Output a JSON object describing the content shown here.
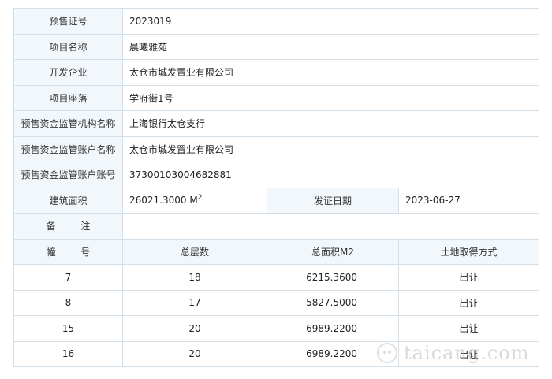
{
  "info": {
    "presale_no_label": "预售证号",
    "presale_no": "2023019",
    "project_name_label": "项目名称",
    "project_name": "晨曦雅苑",
    "developer_label": "开发企业",
    "developer": "太仓市城发置业有限公司",
    "location_label": "项目座落",
    "location": "学府街1号",
    "supervisor_label": "预售资金监管机构名称",
    "supervisor": "上海银行太仓支行",
    "account_name_label": "预售资金监管账户名称",
    "account_name": "太仓市城发置业有限公司",
    "account_no_label": "预售资金监管账户账号",
    "account_no": "37300103004682881",
    "area_label": "建筑面积",
    "area_value": "26021.3000",
    "area_unit": "M",
    "area_unit_sup": "2",
    "issue_date_label": "发证日期",
    "issue_date": "2023-06-27",
    "remarks_label": "备 注",
    "remarks": ""
  },
  "buildings": {
    "headers": {
      "building": "幢 号",
      "floors": "总层数",
      "area": "总面积M2",
      "land": "土地取得方式"
    },
    "rows": [
      {
        "building": "7",
        "floors": "18",
        "area": "6215.3600",
        "land": "出让"
      },
      {
        "building": "8",
        "floors": "17",
        "area": "5827.5000",
        "land": "出让"
      },
      {
        "building": "15",
        "floors": "20",
        "area": "6989.2200",
        "land": "出让"
      },
      {
        "building": "16",
        "floors": "20",
        "area": "6989.2200",
        "land": "出让"
      }
    ]
  },
  "watermark": {
    "text": "taicang.com"
  }
}
